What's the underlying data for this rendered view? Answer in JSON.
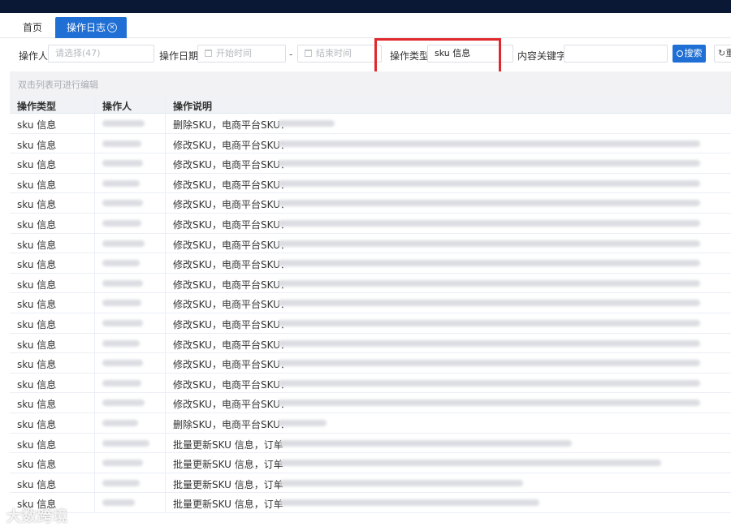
{
  "tabs": [
    {
      "label": "首页"
    },
    {
      "label": "操作日志",
      "close": "⊗"
    }
  ],
  "filters": {
    "operator_label": "操作人",
    "operator_placeholder": "请选择(47)",
    "date_label": "操作日期",
    "start_placeholder": "开始时间",
    "date_separator": "-",
    "end_placeholder": "结束时间",
    "type_label": "操作类型",
    "type_value": "sku 信息",
    "keyword_label": "内容关键字",
    "search_label": "搜索",
    "reset_label": "重"
  },
  "hint": "双击列表可进行编辑",
  "table": {
    "headers": [
      "操作类型",
      "操作人",
      "操作说明"
    ],
    "rows": [
      {
        "type": "sku 信息",
        "desc": "删除SKU，电商平台SKU："
      },
      {
        "type": "sku 信息",
        "desc": "修改SKU，电商平台SKU："
      },
      {
        "type": "sku 信息",
        "desc": "修改SKU，电商平台SKU："
      },
      {
        "type": "sku 信息",
        "desc": "修改SKU，电商平台SKU："
      },
      {
        "type": "sku 信息",
        "desc": "修改SKU，电商平台SKU："
      },
      {
        "type": "sku 信息",
        "desc": "修改SKU，电商平台SKU："
      },
      {
        "type": "sku 信息",
        "desc": "修改SKU，电商平台SKU："
      },
      {
        "type": "sku 信息",
        "desc": "修改SKU，电商平台SKU："
      },
      {
        "type": "sku 信息",
        "desc": "修改SKU，电商平台SKU："
      },
      {
        "type": "sku 信息",
        "desc": "修改SKU，电商平台SKU："
      },
      {
        "type": "sku 信息",
        "desc": "修改SKU，电商平台SKU："
      },
      {
        "type": "sku 信息",
        "desc": "修改SKU，电商平台SKU："
      },
      {
        "type": "sku 信息",
        "desc": "修改SKU，电商平台SKU："
      },
      {
        "type": "sku 信息",
        "desc": "修改SKU，电商平台SKU："
      },
      {
        "type": "sku 信息",
        "desc": "修改SKU，电商平台SKU："
      },
      {
        "type": "sku 信息",
        "desc": "删除SKU，电商平台SKU："
      },
      {
        "type": "sku 信息",
        "desc": "批量更新SKU 信息，订单"
      },
      {
        "type": "sku 信息",
        "desc": "批量更新SKU 信息，订单"
      },
      {
        "type": "sku 信息",
        "desc": "批量更新SKU 信息，订单"
      },
      {
        "type": "sku 信息",
        "desc": "批量更新SKU 信息，订单"
      }
    ]
  },
  "watermark": "大数跨境",
  "colors": {
    "topbar": "#0a1836",
    "primary": "#1f6fd4",
    "highlight_border": "#e0282c"
  }
}
